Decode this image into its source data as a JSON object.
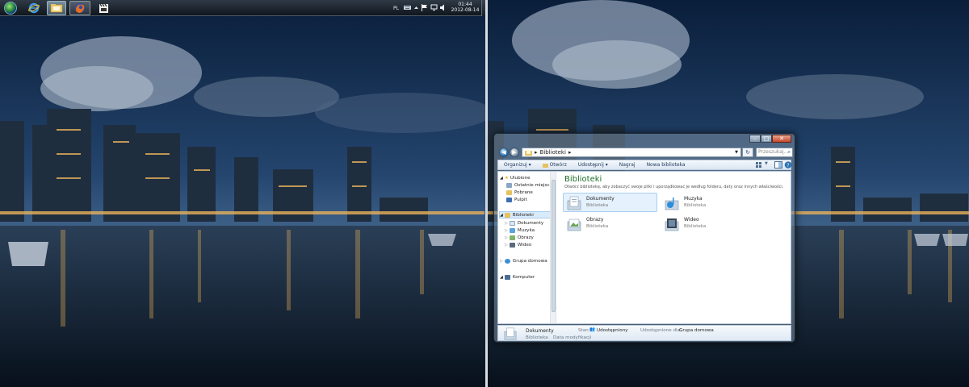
{
  "taskbar": {
    "start": "start-orb",
    "pinned": [
      {
        "name": "Internet Explorer",
        "icon": "internet-explorer-icon"
      },
      {
        "name": "Eksplorator Windows",
        "icon": "folder-libraries-icon"
      },
      {
        "name": "Firefox",
        "icon": "firefox-icon"
      },
      {
        "name": "Media",
        "icon": "clapperboard-icon"
      }
    ],
    "tray": {
      "language": "PL",
      "icons": [
        "keyboard-icon",
        "chevron-up-icon",
        "flag-icon",
        "network-icon",
        "volume-icon"
      ]
    },
    "clock": {
      "time": "01:44",
      "date": "2012-08-14"
    }
  },
  "explorer": {
    "address": {
      "crumbs": [
        "Biblioteki"
      ],
      "search_placeholder": "Przeszukaj..."
    },
    "toolbar": {
      "organize": "Organizuj ▾",
      "open": "Otwórz",
      "share": "Udostępnij ▾",
      "burn": "Nagraj",
      "new_library": "Nowa biblioteka"
    },
    "nav": {
      "favorites": "Ulubione",
      "favorites_items": [
        "Ostatnie miejsca",
        "Pobrane",
        "Pulpit"
      ],
      "libraries": "Biblioteki",
      "libraries_items": [
        "Dokumenty",
        "Muzyka",
        "Obrazy",
        "Wideo"
      ],
      "homegroup": "Grupa domowa",
      "computer": "Komputer"
    },
    "main": {
      "heading": "Biblioteki",
      "description": "Otwórz bibliotekę, aby zobaczyć swoje pliki i uporządkować je według folderu, daty oraz innych właściwości.",
      "libraries": [
        {
          "name": "Dokumenty",
          "sub": "Biblioteka",
          "icon": "documents-library-icon",
          "selected": true
        },
        {
          "name": "Muzyka",
          "sub": "Biblioteka",
          "icon": "music-library-icon",
          "selected": false
        },
        {
          "name": "Obrazy",
          "sub": "Biblioteka",
          "icon": "pictures-library-icon",
          "selected": false
        },
        {
          "name": "Wideo",
          "sub": "Biblioteka",
          "icon": "videos-library-icon",
          "selected": false
        }
      ]
    },
    "details": {
      "name": "Dokumenty",
      "type": "Biblioteka",
      "modified_label": "Data modyfikacji",
      "state_label": "Stan:",
      "state_value": "Udostępniony",
      "shared_label": "Udostępnione dla:",
      "shared_value": "Grupa domowa"
    }
  },
  "colors": {
    "accent": "#1f6f2b",
    "selection": "#e5f1fc",
    "taskbar": "#1b232c"
  }
}
